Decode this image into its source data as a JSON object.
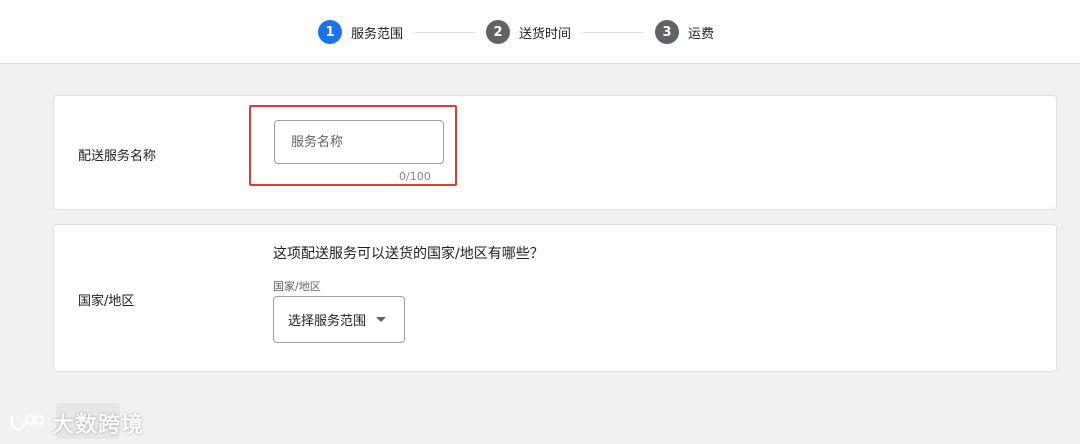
{
  "stepper": {
    "steps": [
      {
        "number": "1",
        "label": "服务范围",
        "state": "active",
        "color": "#1a73e8"
      },
      {
        "number": "2",
        "label": "送货时间",
        "state": "inactive",
        "color": "#5f6368"
      },
      {
        "number": "3",
        "label": "运费",
        "state": "inactive",
        "color": "#5f6368"
      }
    ]
  },
  "service_name_card": {
    "label": "配送服务名称",
    "input_placeholder": "服务名称",
    "input_value": "",
    "char_counter": "0/100",
    "highlight_color": "#e53935"
  },
  "region_card": {
    "label": "国家/地区",
    "question": "这项配送服务可以送货的国家/地区有哪些？",
    "field_label": "国家/地区",
    "select_text": "选择服务范围",
    "select_icon": "caret-down-icon"
  },
  "watermark": {
    "text": "大数跨境",
    "logo_icon": "brand-logo-icon"
  }
}
